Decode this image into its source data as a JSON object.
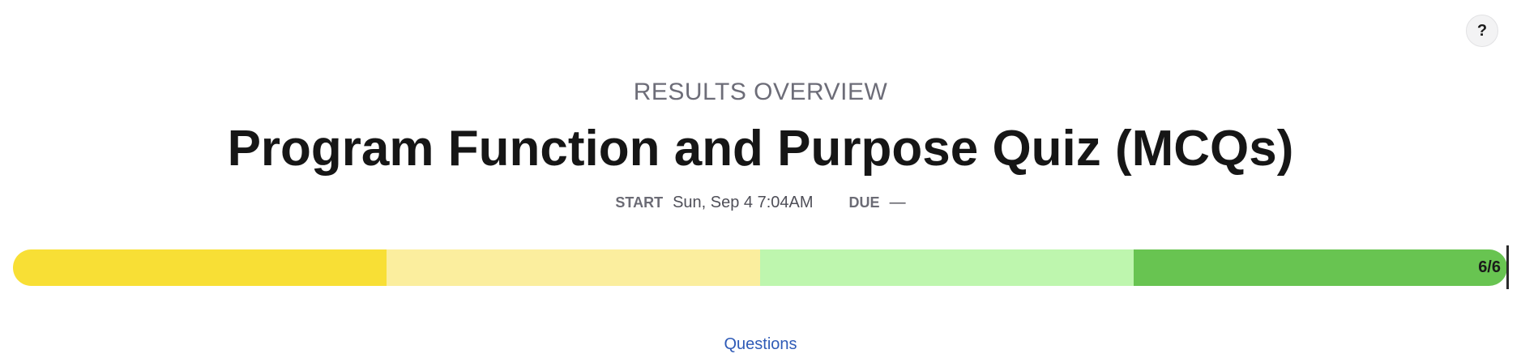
{
  "help": {
    "label": "?"
  },
  "header": {
    "kicker": "RESULTS OVERVIEW",
    "title": "Program Function and Purpose Quiz (MCQs)"
  },
  "meta": {
    "start_label": "START",
    "start_value": "Sun, Sep 4 7:04AM",
    "due_label": "DUE",
    "due_value": "—"
  },
  "progress": {
    "count_text": "6/6",
    "completed": 6,
    "total": 6,
    "segments": [
      {
        "color": "#f8df35"
      },
      {
        "color": "#fbee9e"
      },
      {
        "color": "#bef6ae"
      },
      {
        "color": "#68c451"
      }
    ]
  },
  "nav": {
    "questions_label": "Questions"
  }
}
